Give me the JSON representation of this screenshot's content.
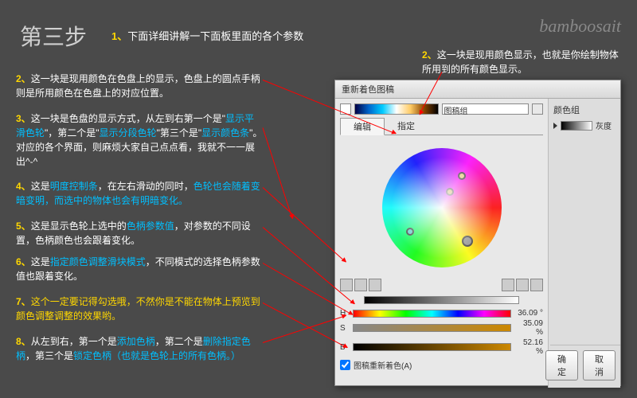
{
  "title": "第三步",
  "watermark": "bamboosait",
  "intro_num": "1、",
  "intro_text": "下面详细讲解一下面板里面的各个参数",
  "top_num": "2、",
  "top_text": "这一块是现用颜色显示，也就是你绘制物体所用到的所有颜色显示。",
  "a2": {
    "n": "2、",
    "t1": "这一块是现用颜色在色盘上的显示，色盘上的圆点手柄则是所用颜色在色盘上的对应位置。"
  },
  "a3": {
    "n": "3、",
    "t1": "这一块是色盘的显示方式，从左到右第一个是\"",
    "h1": "显示平滑色轮",
    "t2": "\"，第二个是\"",
    "h2": "显示分段色轮",
    "t3": "\"第三个是\"",
    "h3": "显示颜色条",
    "t4": "\"。对应的各个界面，则麻烦大家自己点点看，我就不一一展出^-^"
  },
  "a4": {
    "n": "4、",
    "t1": "这是",
    "h1": "明度控制条",
    "t2": "，在左右滑动的同时，",
    "h2": "色轮也会随着变暗变明，而选中的物体也会有明暗变化。"
  },
  "a5": {
    "n": "5、",
    "t1": "这是显示色轮上选中的",
    "h1": "色柄参数值",
    "t2": "，对参数的不同设置，色柄颜色也会跟着变化。"
  },
  "a6": {
    "n": "6、",
    "t1": "这是",
    "h1": "指定颜色调整滑块模式",
    "t2": "，不同模式的选择色柄参数值也跟着变化。"
  },
  "a7": {
    "n": "7、",
    "h1": "这个一定要记得勾选哦，不然你是不能在物体上预览到颜色调整调整的效果哟。"
  },
  "a8": {
    "n": "8、",
    "t1": "从左到右，第一个是",
    "h1": "添加色柄",
    "t2": "，第二个是",
    "h2": "删除指定色柄",
    "t3": "，第三个是",
    "h3": "锁定色柄（也就是色轮上的所有色柄。）"
  },
  "dialog": {
    "title": "重新着色图稿",
    "preset": "图稿组",
    "tab_edit": "编辑",
    "tab_assign": "指定",
    "group_title": "颜色组",
    "swatch_label": "灰度",
    "hsb": {
      "h": {
        "l": "H",
        "v": "36.09 °"
      },
      "s": {
        "l": "S",
        "v": "35.09 %"
      },
      "b": {
        "l": "B",
        "v": "52.16 %"
      }
    },
    "checkbox": "图稿重新着色(A)",
    "ok": "确定",
    "cancel": "取消"
  }
}
